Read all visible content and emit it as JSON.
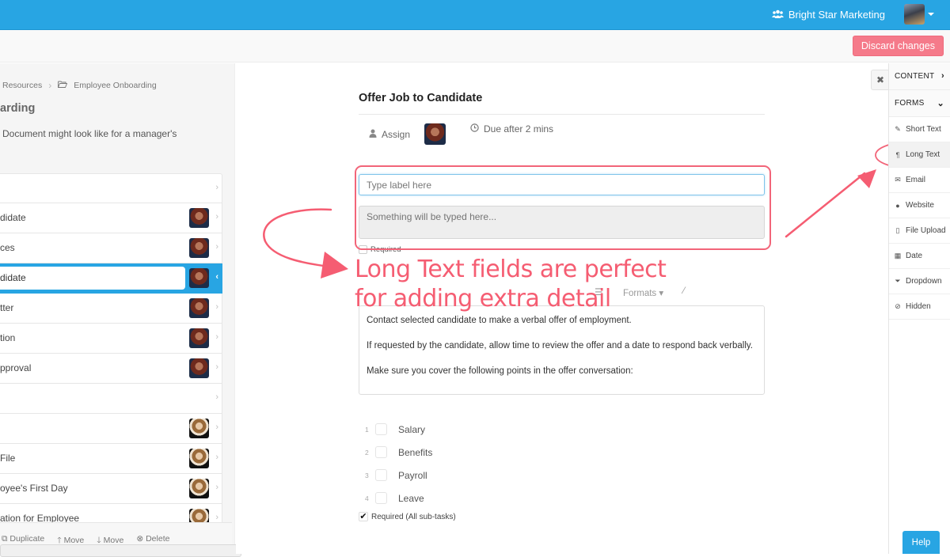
{
  "topbar": {
    "org_name": "Bright Star Marketing",
    "brand_color": "#28a5e3"
  },
  "subbar": {
    "discard_label": "Discard changes"
  },
  "left": {
    "breadcrumb": [
      "Resources",
      "Employee Onboarding"
    ],
    "title": "arding",
    "description": "Document might look like for a manager's",
    "tasks": [
      {
        "label": "",
        "avatar": "none"
      },
      {
        "label": "didate",
        "avatar": "red"
      },
      {
        "label": "ces",
        "avatar": "red"
      },
      {
        "label": "didate",
        "avatar": "red",
        "active": true
      },
      {
        "label": "tter",
        "avatar": "red"
      },
      {
        "label": "tion",
        "avatar": "red"
      },
      {
        "label": "pproval",
        "avatar": "red"
      },
      {
        "label": "",
        "avatar": "none"
      },
      {
        "label": "",
        "avatar": "blonde"
      },
      {
        "label": " File",
        "avatar": "blonde"
      },
      {
        "label": "oyee's First Day",
        "avatar": "blonde"
      },
      {
        "label": "ation for Employee",
        "avatar": "blonde"
      }
    ],
    "footer_actions": [
      "Duplicate",
      "Move",
      "Move",
      "Delete"
    ]
  },
  "editor": {
    "task_title": "Offer Job to Candidate",
    "assign_label": "Assign",
    "due_label": "Due after 2 mins",
    "label_placeholder": "Type label here",
    "long_text_placeholder": "Something will be typed here...",
    "required_label": "Required",
    "toolbar_formats": "Formats",
    "description": [
      "Contact selected candidate to make a verbal offer of employment.",
      "If requested by the candidate, allow time to review the offer and a date to respond back verbally.",
      "Make sure you cover the following points in the offer conversation:"
    ],
    "subtasks": [
      {
        "num": "1",
        "label": "Salary"
      },
      {
        "num": "2",
        "label": "Benefits"
      },
      {
        "num": "3",
        "label": "Payroll"
      },
      {
        "num": "4",
        "label": "Leave"
      }
    ],
    "required_all_label": "Required (All sub-tasks)",
    "required_all_checked": true
  },
  "annotation": {
    "line1": "Long Text fields are perfect",
    "line2": "for adding extra detail",
    "color": "#f55d72"
  },
  "sidebar": {
    "sections": [
      {
        "label": "CONTENT",
        "expanded": false
      },
      {
        "label": "FORMS",
        "expanded": true
      }
    ],
    "items": [
      {
        "label": "Short Text",
        "icon": "edit-icon"
      },
      {
        "label": "Long Text",
        "icon": "pilcrow-icon",
        "highlighted": true
      },
      {
        "label": "Email",
        "icon": "envelope-icon"
      },
      {
        "label": "Website",
        "icon": "globe-icon"
      },
      {
        "label": "File Upload",
        "icon": "file-icon"
      },
      {
        "label": "Date",
        "icon": "calendar-icon"
      },
      {
        "label": "Dropdown",
        "icon": "dropdown-icon"
      },
      {
        "label": "Hidden",
        "icon": "eye-slash-icon"
      }
    ]
  },
  "help_label": "Help"
}
